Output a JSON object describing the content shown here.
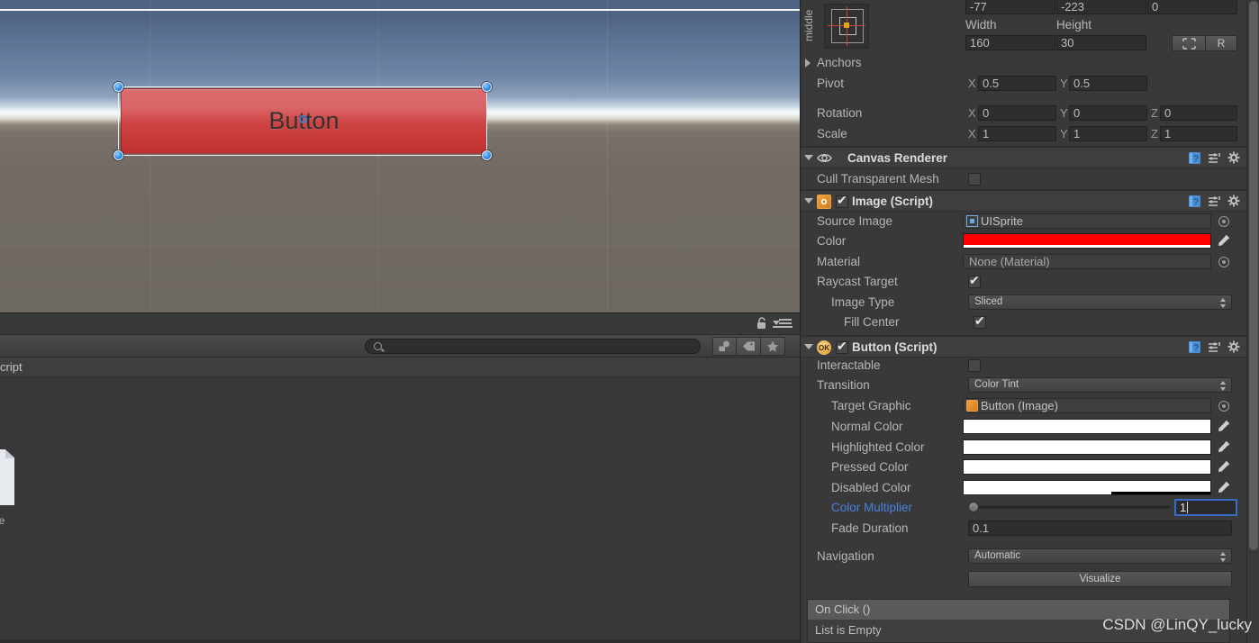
{
  "scene": {
    "button_label": "Button"
  },
  "project_panel": {
    "breadcrumb": "cript",
    "search_placeholder": "",
    "search_value": "",
    "asset_label": "pe",
    "icons": {
      "lock": "lock-icon",
      "menu": "panel-menu-icon",
      "search": "search-icon",
      "filter_type": "filter-by-type-icon",
      "filter_label": "filter-by-label-icon",
      "filter_favorite": "favorite-star-icon"
    }
  },
  "inspector": {
    "rect_transform": {
      "anchor_preset_label": "middle",
      "pos_row": {
        "x": "-77",
        "y": "-223",
        "z": "0"
      },
      "size_headers": {
        "width": "Width",
        "height": "Height"
      },
      "size_row": {
        "width": "160",
        "height": "30"
      },
      "blueprint_btn": "",
      "raw_btn": "R",
      "anchors_label": "Anchors",
      "pivot_label": "Pivot",
      "pivot": {
        "x_axis": "X",
        "x": "0.5",
        "y_axis": "Y",
        "y": "0.5"
      },
      "rotation_label": "Rotation",
      "rotation": {
        "x_axis": "X",
        "x": "0",
        "y_axis": "Y",
        "y": "0",
        "z_axis": "Z",
        "z": "0"
      },
      "scale_label": "Scale",
      "scale": {
        "x_axis": "X",
        "x": "1",
        "y_axis": "Y",
        "y": "1",
        "z_axis": "Z",
        "z": "1"
      }
    },
    "canvas_renderer": {
      "title": "Canvas Renderer",
      "cull_label": "Cull Transparent Mesh",
      "cull_checked": false
    },
    "image_script": {
      "title": "Image (Script)",
      "enabled": true,
      "source_image_label": "Source Image",
      "source_image_value": "UISprite",
      "color_label": "Color",
      "color_value": "#FF0000",
      "color_alpha": "#FFFFFF",
      "material_label": "Material",
      "material_value": "None (Material)",
      "raycast_label": "Raycast Target",
      "raycast_checked": true,
      "image_type_label": "Image Type",
      "image_type_value": "Sliced",
      "fill_center_label": "Fill Center",
      "fill_center_checked": true
    },
    "button_script": {
      "title": "Button (Script)",
      "enabled": true,
      "interactable_label": "Interactable",
      "interactable_checked": false,
      "transition_label": "Transition",
      "transition_value": "Color Tint",
      "target_graphic_label": "Target Graphic",
      "target_graphic_value": "Button (Image)",
      "normal_color_label": "Normal Color",
      "normal_color_value": "#FFFFFF",
      "highlighted_color_label": "Highlighted Color",
      "highlighted_color_value": "#FFFFFF",
      "pressed_color_label": "Pressed Color",
      "pressed_color_value": "#FFFFFF",
      "disabled_color_label": "Disabled Color",
      "disabled_color_value": "#FFFFFF",
      "disabled_color_alpha_pct": 60,
      "color_multiplier_label": "Color Multiplier",
      "color_multiplier_value": "1",
      "color_multiplier_slider_pct": 0,
      "fade_duration_label": "Fade Duration",
      "fade_duration_value": "0.1",
      "navigation_label": "Navigation",
      "navigation_value": "Automatic",
      "visualize_button": "Visualize",
      "on_click_title": "On Click ()",
      "on_click_empty": "List is Empty"
    },
    "icons": {
      "help": "help-book-icon",
      "preset": "preset-sliders-icon",
      "settings": "gear-icon",
      "eye": "eye-visibility-icon",
      "eyedropper": "eyedropper-icon",
      "object_picker": "object-picker-icon"
    }
  },
  "watermark": "CSDN @LinQY_lucky",
  "colors": {
    "panel_bg": "#393939",
    "field_bg": "#2e2e2e",
    "accent_blue": "#3a6ec6",
    "button_red": "#cf4444",
    "image_color": "#FF0000"
  }
}
